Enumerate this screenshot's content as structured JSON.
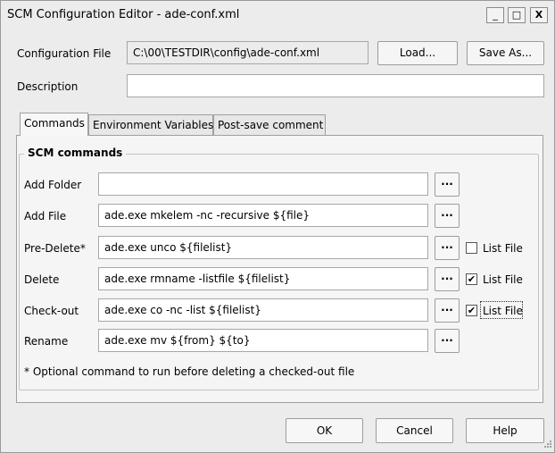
{
  "window": {
    "title": "SCM Configuration Editor - ade-conf.xml"
  },
  "titlebar": {
    "min_glyph": "_",
    "max_glyph": "□",
    "close_glyph": "X"
  },
  "config": {
    "file_label": "Configuration File",
    "file_value": "C:\\00\\TESTDIR\\config\\ade-conf.xml",
    "load_label": "Load...",
    "save_as_label": "Save As...",
    "description_label": "Description",
    "description_value": ""
  },
  "tabs": [
    {
      "label": "Commands",
      "active": true
    },
    {
      "label": "Environment Variables",
      "active": false
    },
    {
      "label": "Post-save comment",
      "active": false
    }
  ],
  "group": {
    "title": "SCM commands"
  },
  "commands": [
    {
      "label": "Add Folder",
      "value": "",
      "has_list_file": false
    },
    {
      "label": "Add File",
      "value": "ade.exe mkelem -nc -recursive ${file}",
      "has_list_file": false
    },
    {
      "label": "Pre-Delete*",
      "value": "ade.exe unco ${filelist}",
      "has_list_file": true,
      "list_file_checked": false
    },
    {
      "label": "Delete",
      "value": "ade.exe rmname -listfile ${filelist}",
      "has_list_file": true,
      "list_file_checked": true
    },
    {
      "label": "Check-out",
      "value": "ade.exe co -nc -list ${filelist}",
      "has_list_file": true,
      "list_file_checked": true
    },
    {
      "label": "Rename",
      "value": "ade.exe mv ${from} ${to}",
      "has_list_file": false
    }
  ],
  "list_file_label": "List File",
  "browse_label": "...",
  "check_glyph": "✔",
  "footnote": "* Optional command to run before deleting a checked-out file",
  "footer": {
    "ok_label": "OK",
    "cancel_label": "Cancel",
    "help_label": "Help"
  }
}
